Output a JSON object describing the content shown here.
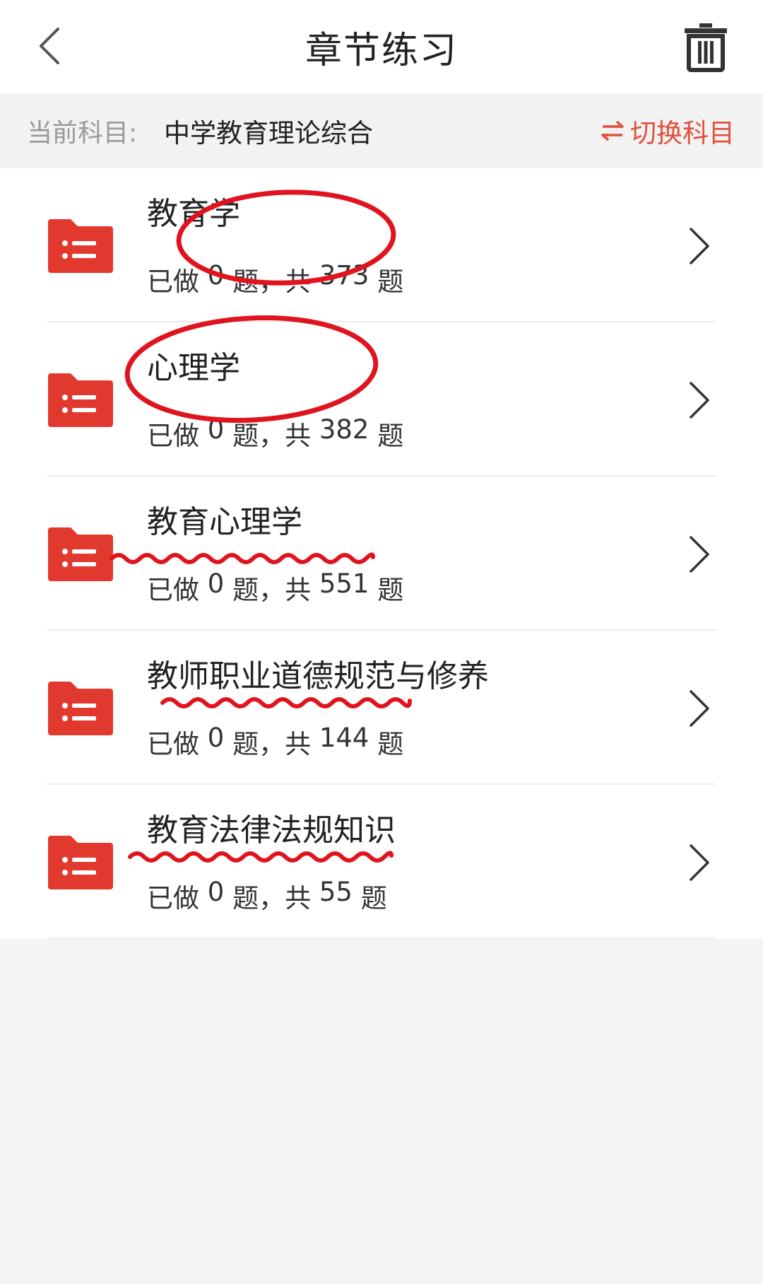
{
  "header": {
    "title": "章节练习",
    "back_icon": "chevron-left-icon",
    "trash_icon": "trash-icon"
  },
  "subject_bar": {
    "label": "当前科目:",
    "subject": "中学教育理论综合",
    "switch_label": "切换科目",
    "switch_icon": "swap-arrows-icon"
  },
  "chapters": [
    {
      "title": "教育学",
      "done_prefix": "已做 ",
      "done": "0",
      "mid": " 题，共 ",
      "total": "373",
      "suffix": " 题"
    },
    {
      "title": "心理学",
      "done_prefix": "已做 ",
      "done": "0",
      "mid": " 题，共 ",
      "total": "382",
      "suffix": " 题"
    },
    {
      "title": "教育心理学",
      "done_prefix": "已做 ",
      "done": "0",
      "mid": " 题，共 ",
      "total": "551",
      "suffix": " 题"
    },
    {
      "title": "教师职业道德规范与修养",
      "done_prefix": "已做 ",
      "done": "0",
      "mid": " 题，共 ",
      "total": "144",
      "suffix": " 题"
    },
    {
      "title": "教育法律法规知识",
      "done_prefix": "已做 ",
      "done": "0",
      "mid": " 题，共 ",
      "total": "55",
      "suffix": " 题"
    }
  ],
  "colors": {
    "accent": "#e1503c",
    "folder": "#e2392f",
    "annotation": "#e0141e",
    "background": "#f4f4f4"
  }
}
